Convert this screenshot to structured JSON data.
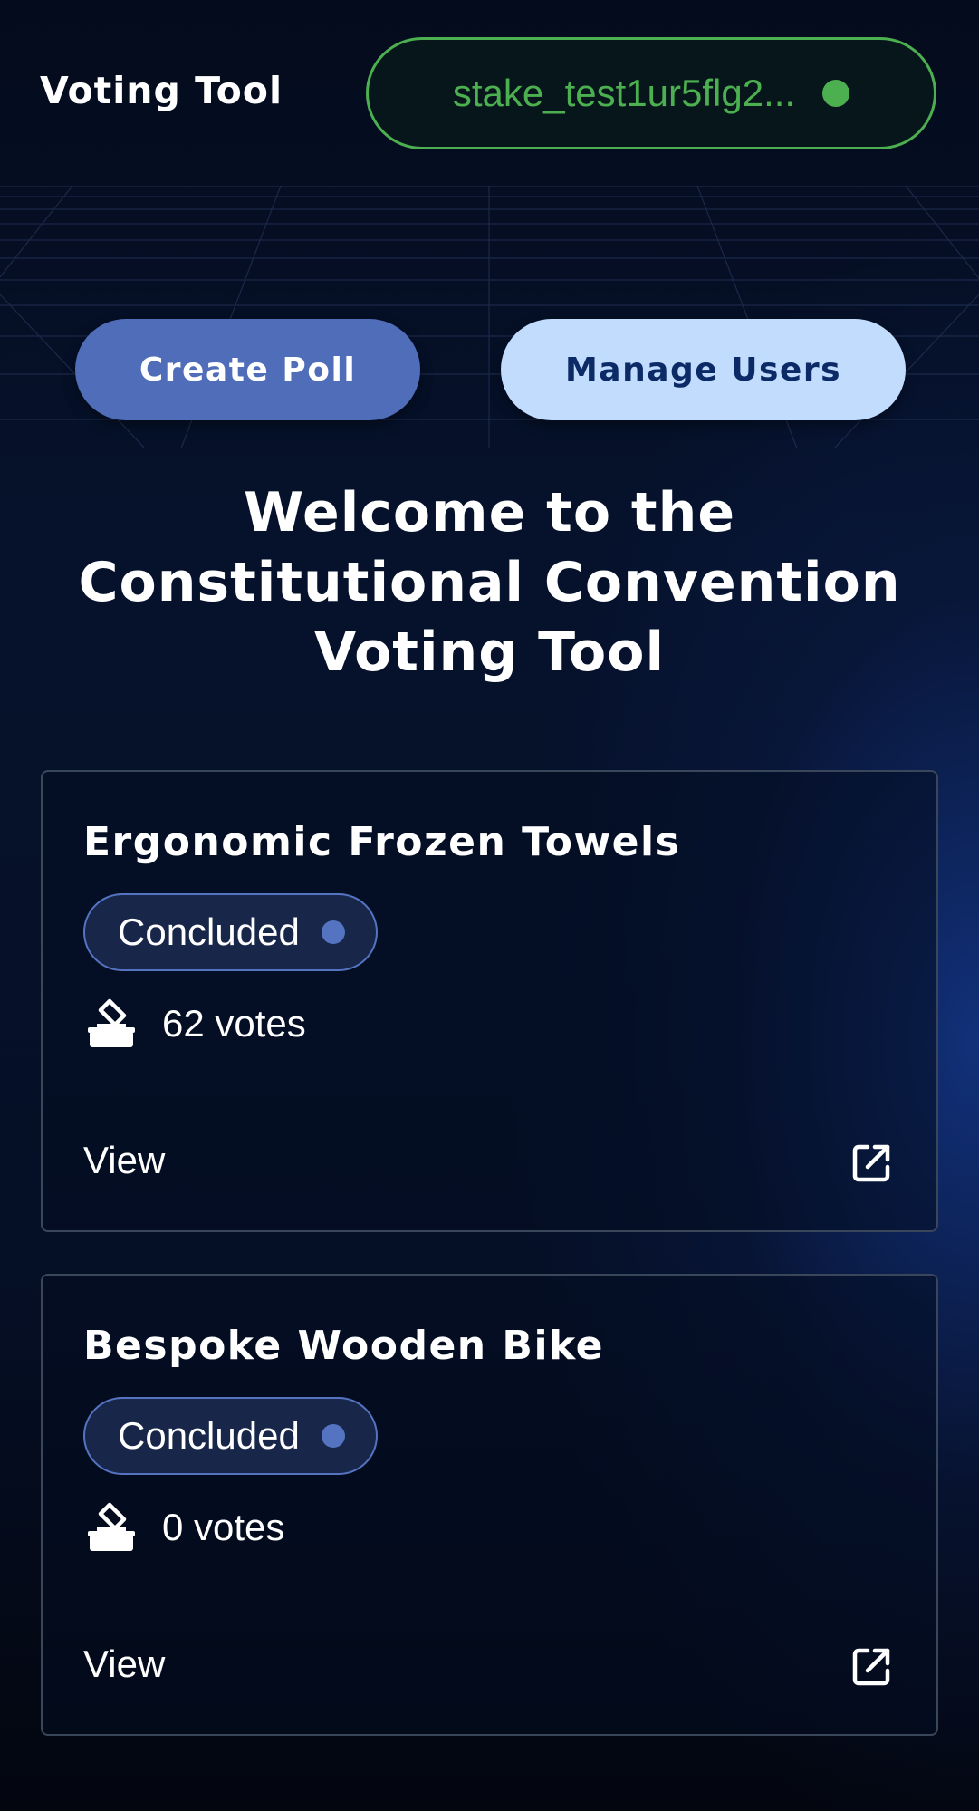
{
  "header": {
    "app_title": "Voting Tool",
    "wallet": {
      "address": "stake_test1ur5flg2...",
      "status_color": "#4caf50"
    }
  },
  "actions": {
    "create_poll_label": "Create Poll",
    "manage_users_label": "Manage Users"
  },
  "welcome": {
    "line1": "Welcome to the",
    "line2": "Constitutional Convention",
    "line3": "Voting Tool"
  },
  "polls": [
    {
      "title": "Ergonomic Frozen Towels",
      "status": "Concluded",
      "votes": "62 votes",
      "view_label": "View",
      "vote_icon": "ballot-box-icon",
      "link_icon": "external-link-icon"
    },
    {
      "title": "Bespoke Wooden Bike",
      "status": "Concluded",
      "votes": "0 votes",
      "view_label": "View",
      "vote_icon": "ballot-box-icon",
      "link_icon": "external-link-icon"
    }
  ],
  "colors": {
    "wallet_green": "#4caf50",
    "primary_button": "#4f6db8",
    "secondary_button": "#c2dcfd",
    "secondary_button_text": "#0c2a66",
    "status_accent": "#5474c2"
  }
}
